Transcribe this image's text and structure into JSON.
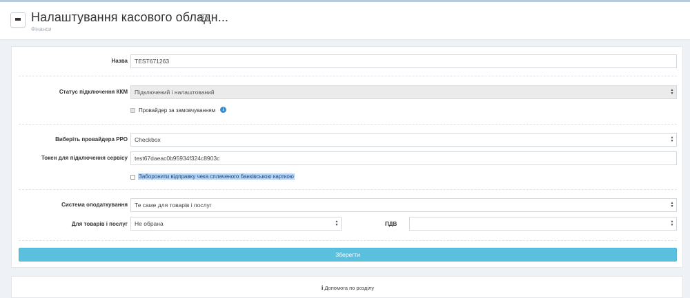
{
  "header": {
    "title": "Налаштування касового обладн...",
    "breadcrumb": "Фінанси",
    "menu_icon": "hamburger-icon",
    "info_icon": "info-circle-icon"
  },
  "form": {
    "name_label": "Назва",
    "name_value": "TEST671263",
    "status_label": "Статус підключення ККМ",
    "status_value": "Підключений і налаштований",
    "default_provider_label": "Провайдер за замовчуванням",
    "default_provider_checked": false,
    "provider_label": "Виберіть провайдера РРО",
    "provider_value": "Checkbox",
    "token_label": "Токен для підключення сервісу",
    "token_value": "test67daeac0b95934f324c8903c",
    "forbid_label": "Заборонити відправку чека сплаченого банківською карткою",
    "forbid_checked": false,
    "tax_system_label": "Система оподаткування",
    "tax_system_value": "Те саме для товарів і послуг",
    "goods_label": "Для товарів і послуг",
    "goods_value": "Не обрана",
    "vat_label": "ПДВ",
    "vat_value": "",
    "save_label": "Зберегти"
  },
  "footer": {
    "help_icon": "i",
    "help_label": "Допомога по розділу"
  },
  "colors": {
    "accent": "#5bc0de",
    "info": "#3a8ecf",
    "selection": "#b5d3f3"
  }
}
